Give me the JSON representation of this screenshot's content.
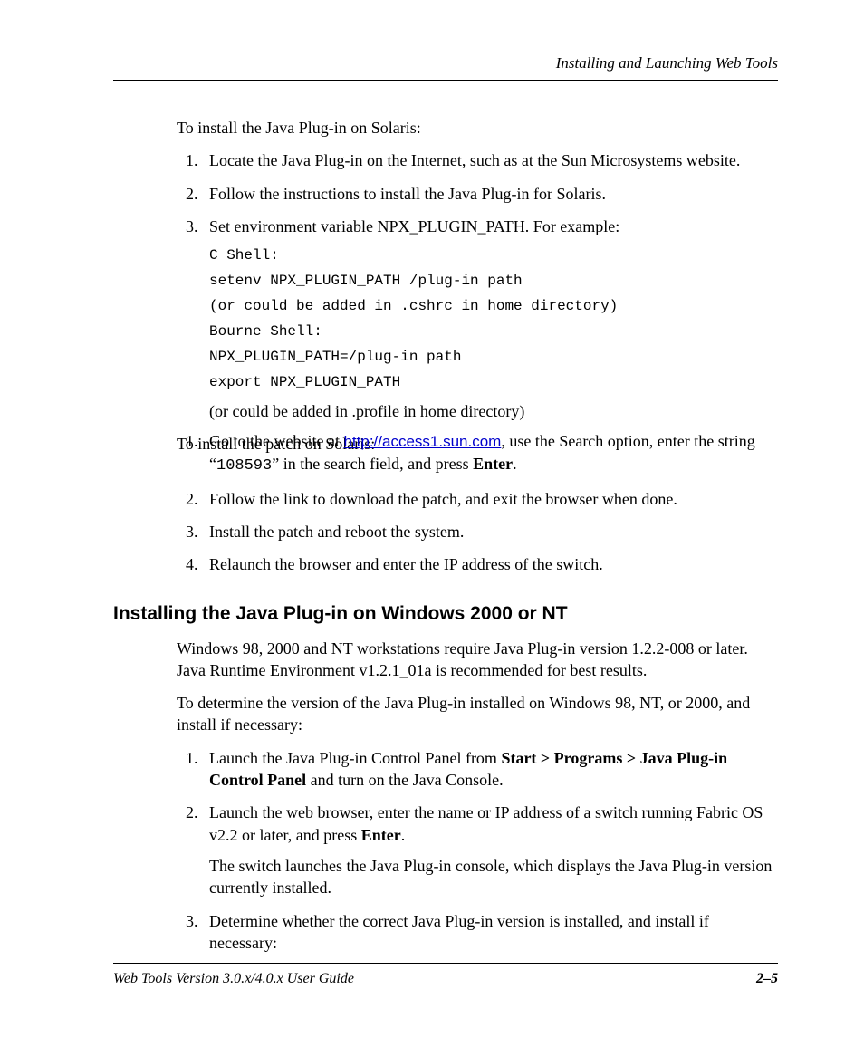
{
  "header": {
    "chapter_title": "Installing and Launching Web Tools"
  },
  "intro1": "To install the Java Plug-in on Solaris:",
  "list1": {
    "item1": "Locate the Java Plug-in on the Internet, such as at the Sun Microsystems website.",
    "item2": "Follow the instructions to install the Java Plug-in for Solaris.",
    "item3": "Set environment variable NPX_PLUGIN_PATH. For example:"
  },
  "code": {
    "l1": "C Shell:",
    "l2": "setenv NPX_PLUGIN_PATH /plug-in path",
    "l3": "(or could be added in .cshrc in home directory)",
    "l4": "Bourne Shell:",
    "l5": "NPX_PLUGIN_PATH=/plug-in path",
    "l6": "export NPX_PLUGIN_PATH"
  },
  "code_note": "(or could be added in .profile in home directory)",
  "intro2": "To install the patch on Solaris:",
  "list2": {
    "item1_pre": "Go to the website at ",
    "item1_link": "http://access1.sun.com",
    "item1_mid": ", use the Search option, enter the string “",
    "item1_code": "108593",
    "item1_post": "” in the search field, and press ",
    "item1_bold": "Enter",
    "item1_end": ".",
    "item2": "Follow the link to download the patch, and exit the browser when done.",
    "item3": "Install the patch and reboot the system.",
    "item4": "Relaunch the browser and enter the IP address of the switch."
  },
  "section_heading": "Installing the Java Plug-in on Windows 2000 or NT",
  "para_win1": "Windows 98, 2000 and NT workstations require Java Plug-in version 1.2.2-008 or later. Java Runtime Environment v1.2.1_01a is recommended for best results.",
  "para_win2": "To determine the version of the Java Plug-in installed on Windows 98, NT, or 2000, and install if necessary:",
  "list3": {
    "item1_pre": "Launch the Java Plug-in Control Panel from ",
    "item1_bold": "Start > Programs > Java Plug-in Control Panel",
    "item1_post": " and turn on the Java Console.",
    "item2_pre": "Launch the web browser, enter the name or IP address of a switch running Fabric OS v2.2 or later, and press ",
    "item2_bold": "Enter",
    "item2_post": ".",
    "item2_sub": "The switch launches the Java Plug-in console, which displays the Java Plug-in version currently installed.",
    "item3": "Determine whether the correct Java Plug-in version is installed, and install if necessary:"
  },
  "footer": {
    "left": "Web Tools Version 3.0.x/4.0.x User Guide",
    "right": "2–5"
  }
}
